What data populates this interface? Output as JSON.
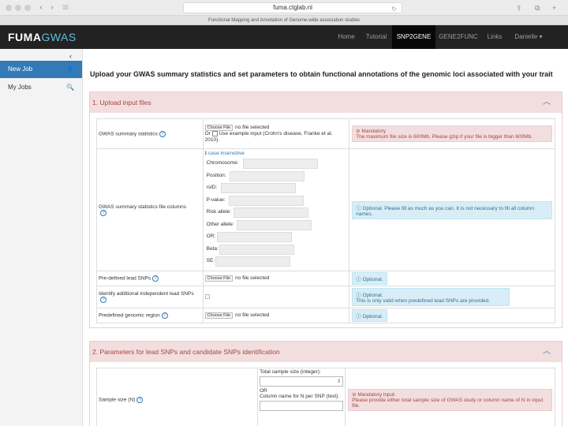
{
  "browser": {
    "url": "fuma.ctglab.nl",
    "tab_title": "Functional Mapping and Annotation of Genome-wide association studies",
    "back": "‹",
    "forward": "›",
    "sidebar_toggle": "▯▯",
    "reload": "↻"
  },
  "navbar": {
    "brand_main": "FUMA",
    "brand_accent": "GWAS",
    "items": [
      "Home",
      "Tutorial",
      "SNP2GENE",
      "GENE2FUNC",
      "Links",
      "Danielle ▾"
    ]
  },
  "sidebar": {
    "collapse": "‹",
    "items": [
      {
        "label": "New Job",
        "icon": "user-plus-icon"
      },
      {
        "label": "My Jobs",
        "icon": "search-icon"
      }
    ]
  },
  "main": {
    "title": "Upload your GWAS summary statistics and set parameters to obtain functional annotations of the genomic loci associated with your trait"
  },
  "section1": {
    "title": "1. Upload input files",
    "gwas_label": "GWAS summary statistics",
    "choose_file": "Choose File",
    "no_file": "no file selected",
    "or_text": "Or",
    "example_text": "Use example input (Crohn's disease, Franke et al. 2010).",
    "mandatory": "Mandatory",
    "mandatory_desc": "The maximum file size is 600Mb. Please gzip if your file is bigger than 600Mb.",
    "columns_label": "GWAS summary statistics file columns",
    "case_note": "case insensitive",
    "columns": [
      "Chromosome:",
      "Position:",
      "rsID:",
      "P-value:",
      "Risk allele:",
      "Other allele:",
      "OR:",
      "Beta:",
      "SE:"
    ],
    "columns_note": "Optional. Please fill as much as you can. It is not necessary to fill all column names.",
    "lead_label": "Pre-defined lead SNPs",
    "lead_note": "Optional.",
    "identify_label": "Identify additional independent lead SNPs",
    "identify_note_title": "Optional.",
    "identify_note": "This is only valid when predefined lead SNPs are provided.",
    "region_label": "Predefined genomic region",
    "region_note": "Optional."
  },
  "section2": {
    "title": "2. Parameters for lead SNPs and candidate SNPs identification",
    "sample_label": "Sample size (N)",
    "total_label": "Total sample size (integer):",
    "or_text": "OR",
    "colname_label": "Column name for N per SNP (text):",
    "mandatory": "Mandatory input.",
    "mandatory_desc": "Please provide either total sample size of GWAS study or column name of N in input file."
  }
}
